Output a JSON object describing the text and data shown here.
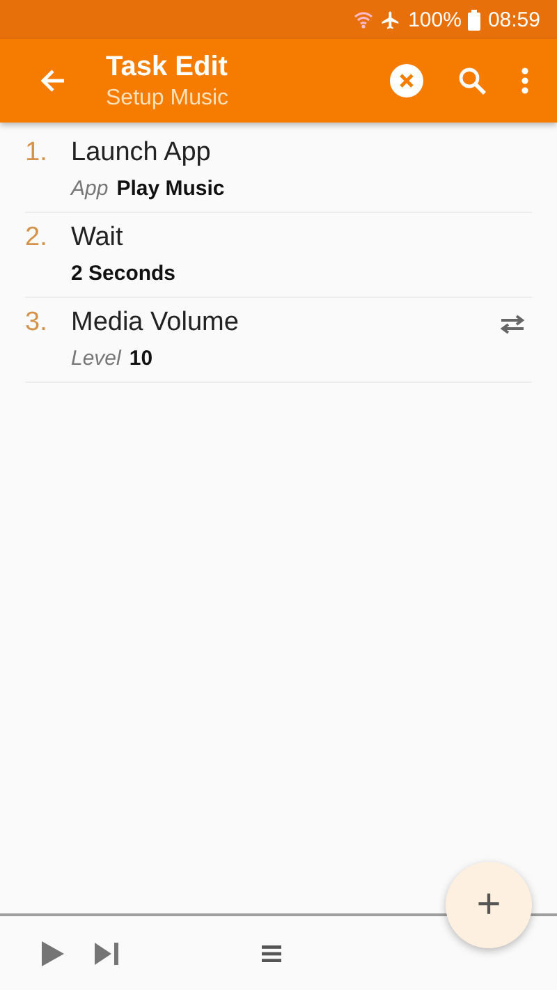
{
  "status_bar": {
    "battery": "100%",
    "time": "08:59"
  },
  "toolbar": {
    "title": "Task Edit",
    "subtitle": "Setup Music"
  },
  "actions": [
    {
      "index": "1.",
      "name": "Launch App",
      "param_label": "App",
      "param_value": "Play Music",
      "kind": "plain"
    },
    {
      "index": "2.",
      "name": "Wait",
      "param_value": "2 Seconds",
      "kind": "plain"
    },
    {
      "index": "3.",
      "name": "Media Volume",
      "param_label": "Level",
      "param_value": "10",
      "kind": "swap"
    }
  ],
  "fab": {
    "label": "+"
  }
}
